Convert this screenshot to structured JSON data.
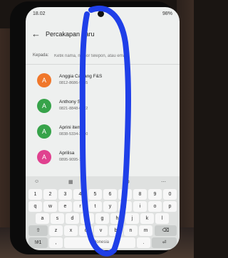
{
  "status": {
    "time": "18.02",
    "battery": "98%"
  },
  "header": {
    "title": "Percakapan baru"
  },
  "recipient": {
    "label": "Kepada:",
    "placeholder": "Ketik nama, nomor telepon, atau email"
  },
  "contacts": [
    {
      "initial": "A",
      "name": "Anggia Cawang F&S",
      "phone": "0812-8686-9055",
      "color": "#f0772a"
    },
    {
      "initial": "A",
      "name": "Anthony SJ",
      "phone": "0821-8848-6622",
      "color": "#37a34a"
    },
    {
      "initial": "A",
      "name": "Aprini item",
      "phone": "0838-5334-3040",
      "color": "#37a34a"
    },
    {
      "initial": "A",
      "name": "Aprilisa",
      "phone": "0895-9095-1...",
      "color": "#e0418f"
    }
  ],
  "keyboard": {
    "toolbar": [
      "☺",
      "▦",
      "⚙",
      "⋯"
    ],
    "numbers": [
      "1",
      "2",
      "3",
      "4",
      "5",
      "6",
      "7",
      "8",
      "9",
      "0"
    ],
    "row1": [
      "q",
      "w",
      "e",
      "r",
      "t",
      "y",
      "u",
      "i",
      "o",
      "p"
    ],
    "row2": [
      "a",
      "s",
      "d",
      "f",
      "g",
      "h",
      "j",
      "k",
      "l"
    ],
    "row3": [
      "⇧",
      "z",
      "x",
      "c",
      "v",
      "b",
      "n",
      "m",
      "⌫"
    ],
    "row4": [
      "!#1",
      ",",
      "Indonesia",
      ".",
      "⏎"
    ]
  },
  "colors": {
    "scribble": "#1f3fe8"
  }
}
